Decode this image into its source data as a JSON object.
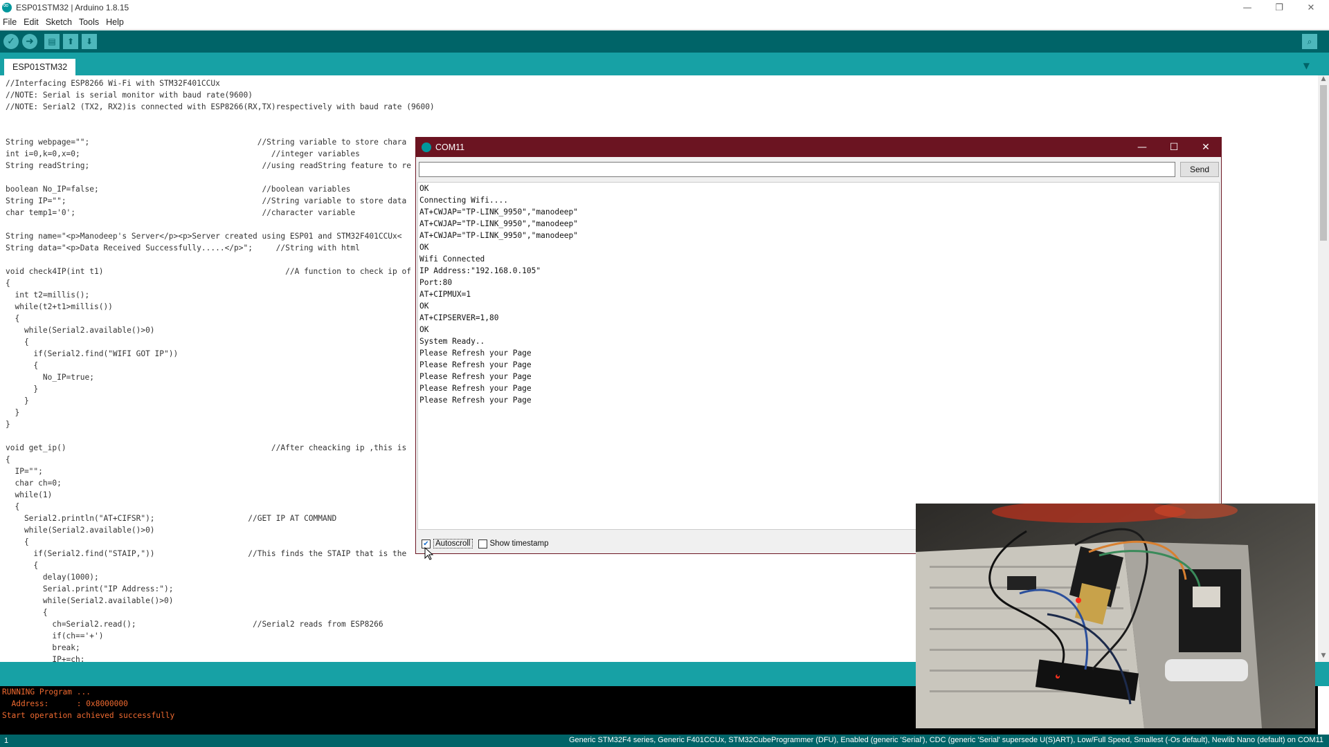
{
  "window": {
    "title": "ESP01STM32 | Arduino 1.8.15",
    "controls": {
      "minimize": "—",
      "restore": "❐",
      "close": "✕"
    }
  },
  "menu": [
    "File",
    "Edit",
    "Sketch",
    "Tools",
    "Help"
  ],
  "toolbar": {
    "verify_icon": "check-icon",
    "upload_icon": "arrow-right-icon",
    "new_icon": "new-file-icon",
    "open_icon": "arrow-up-icon",
    "save_icon": "arrow-down-icon",
    "serial_monitor_icon": "magnifier-icon",
    "verify_glyph": "✓",
    "upload_glyph": "➜",
    "new_glyph": "▤",
    "open_glyph": "⬆",
    "save_glyph": "⬇",
    "serial_glyph": "⌕"
  },
  "tabs": [
    {
      "label": "ESP01STM32"
    }
  ],
  "tab_menu_glyph": "▼",
  "editor": {
    "lines": [
      "//Interfacing ESP8266 Wi-Fi with STM32F401CCUx",
      "//NOTE: Serial is serial monitor with baud rate(9600)",
      "//NOTE: Serial2 (TX2, RX2)is connected with ESP8266(RX,TX)respectively with baud rate (9600)",
      "",
      "",
      "String webpage=\"\";                                    //String variable to store chara",
      "int i=0,k=0,x=0;                                         //integer variables",
      "String readString;                                     //using readString feature to re",
      "",
      "boolean No_IP=false;                                   //boolean variables",
      "String IP=\"\";                                          //String variable to store data",
      "char temp1='0';                                        //character variable",
      "",
      "String name=\"<p>Manodeep's Server</p><p>Server created using ESP01 and STM32F401CCUx<",
      "String data=\"<p>Data Received Successfully.....</p>\";     //String with html",
      "",
      "void check4IP(int t1)                                       //A function to check ip of",
      "{",
      "  int t2=millis();",
      "  while(t2+t1>millis())",
      "  {",
      "    while(Serial2.available()>0)",
      "    {",
      "      if(Serial2.find(\"WIFI GOT IP\"))",
      "      {",
      "        No_IP=true;",
      "      }",
      "    }",
      "  }",
      "}",
      "",
      "void get_ip()                                            //After cheacking ip ,this is",
      "{",
      "  IP=\"\";",
      "  char ch=0;",
      "  while(1)",
      "  {",
      "    Serial2.println(\"AT+CIFSR\");                    //GET IP AT COMMAND",
      "    while(Serial2.available()>0)",
      "    {",
      "      if(Serial2.find(\"STAIP,\"))                    //This finds the STAIP that is the",
      "      {",
      "        delay(1000);",
      "        Serial.print(\"IP Address:\");",
      "        while(Serial2.available()>0)",
      "        {",
      "          ch=Serial2.read();                         //Serial2 reads from ESP8266",
      "          if(ch=='+')",
      "          break;",
      "          IP+=ch;"
    ]
  },
  "serial_monitor": {
    "title": "COM11",
    "input_value": "",
    "send_label": "Send",
    "output": [
      "OK",
      "Connecting Wifi....",
      "AT+CWJAP=\"TP-LINK_9950\",\"manodeep\"",
      "AT+CWJAP=\"TP-LINK_9950\",\"manodeep\"",
      "AT+CWJAP=\"TP-LINK_9950\",\"manodeep\"",
      "OK",
      "Wifi Connected",
      "IP Address:\"192.168.0.105\"",
      "Port:80",
      "AT+CIPMUX=1",
      "OK",
      "AT+CIPSERVER=1,80",
      "OK",
      "System Ready..",
      "Please Refresh your Page",
      "Please Refresh your Page",
      "Please Refresh your Page",
      "Please Refresh your Page",
      "Please Refresh your Page"
    ],
    "autoscroll_label": "Autoscroll",
    "autoscroll_checked": true,
    "timestamp_label": "Show timestamp",
    "timestamp_checked": false
  },
  "console": {
    "lines": [
      "RUNNING Program ...",
      "  Address:      : 0x8000000",
      "Start operation achieved successfully"
    ]
  },
  "status": {
    "line": "1",
    "board": "Generic STM32F4 series, Generic F401CCUx, STM32CubeProgrammer (DFU), Enabled (generic 'Serial'), CDC (generic 'Serial' supersede U(S)ART), Low/Full Speed, Smallest (-Os default), Newlib Nano (default) on COM11"
  },
  "colors": {
    "toolbar": "#006468",
    "tabstrip": "#17a1a5",
    "serial_title": "#6b1421",
    "console_text": "#f06a30"
  }
}
